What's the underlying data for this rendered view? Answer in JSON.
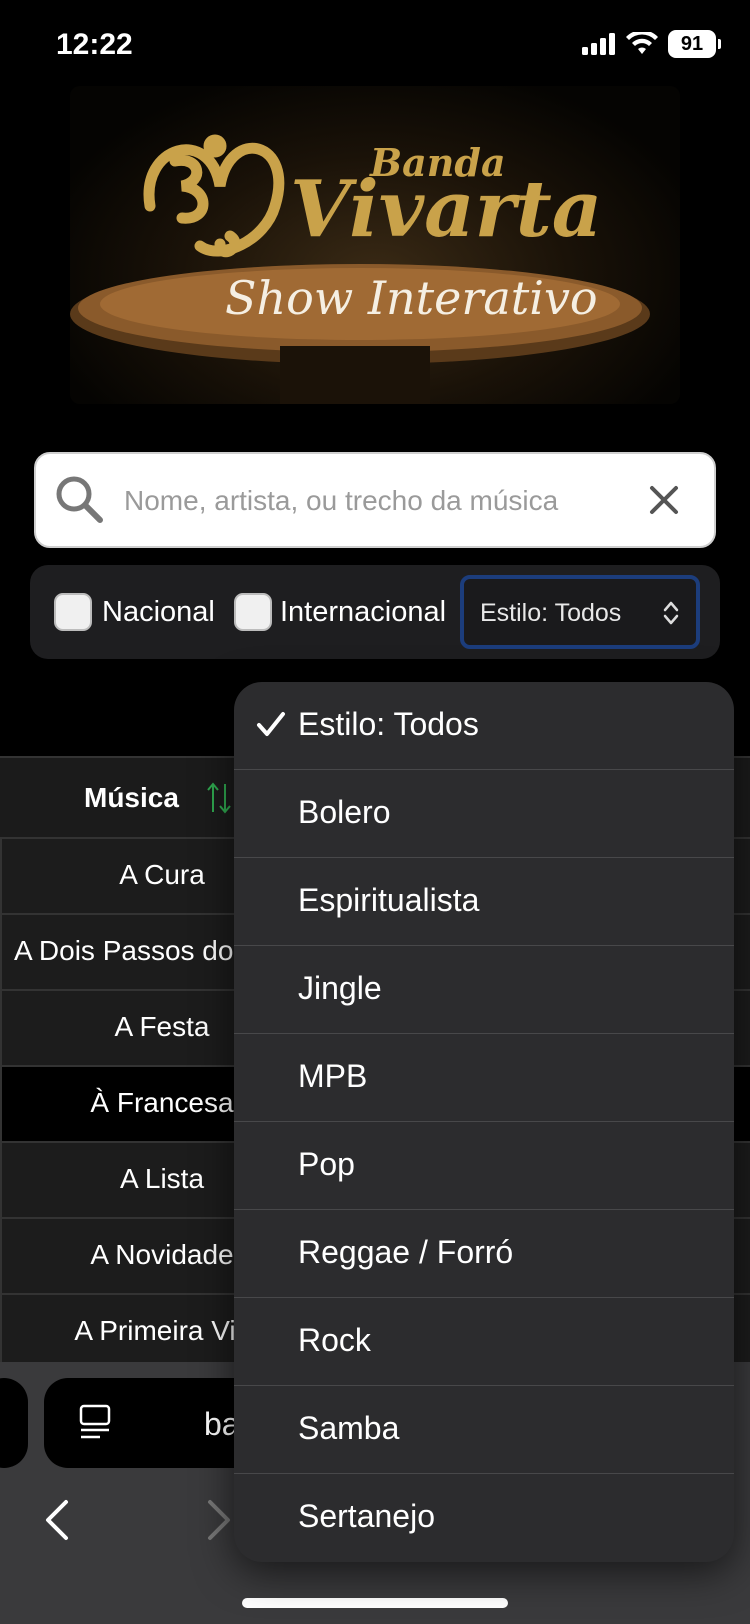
{
  "status_bar": {
    "time": "12:22",
    "battery": "91"
  },
  "banner": {
    "brand_line1": "Banda",
    "brand_line2": "Vivarta",
    "tagline": "Show Interativo"
  },
  "search": {
    "placeholder": "Nome, artista, ou trecho da música"
  },
  "filters": {
    "nacional_label": "Nacional",
    "internacional_label": "Internacional",
    "style_select_value": "Estilo: Todos"
  },
  "table": {
    "header_music": "Música",
    "rows": [
      "A Cura",
      "A Dois Passos do",
      "A Festa",
      "À Francesa",
      "A Lista",
      "A Novidade",
      "A Primeira Vis"
    ]
  },
  "browser": {
    "address_text": "ba"
  },
  "style_menu": {
    "items": [
      "Estilo: Todos",
      "Bolero",
      "Espiritualista",
      "Jingle",
      "MPB",
      "Pop",
      "Reggae / Forró",
      "Rock",
      "Samba",
      "Sertanejo"
    ],
    "selected_index": 0
  },
  "colors": {
    "accent_gold": "#c9a24a",
    "select_border": "#1c3d7c",
    "sort_icon": "#2fa84f"
  }
}
